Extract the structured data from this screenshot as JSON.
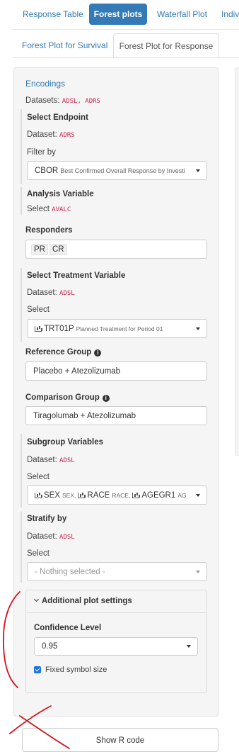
{
  "top_tabs": [
    "Response Table",
    "Forest plots",
    "Waterfall Plot",
    "Indiv"
  ],
  "sub_tabs": [
    "Forest Plot for Survival",
    "Forest Plot for Response"
  ],
  "encodings": {
    "title": "Encodings",
    "datasets_label": "Datasets:",
    "datasets_value": "ADSL, ADRS",
    "endpoint": {
      "title": "Select Endpoint",
      "dataset_label": "Dataset:",
      "dataset_value": "ADRS",
      "filter_label": "Filter by",
      "filter_value": "CBOR",
      "filter_desc": "Best Confirmed Overall Response by Investi"
    },
    "analysis": {
      "title": "Analysis Variable",
      "select_label": "Select",
      "select_value": "AVALC"
    },
    "responders": {
      "title": "Responders",
      "chips": [
        "PR",
        "CR"
      ]
    },
    "treatment": {
      "title": "Select Treatment Variable",
      "dataset_label": "Dataset:",
      "dataset_value": "ADSL",
      "select_label": "Select",
      "value": "TRT01P",
      "desc": "Planned Treatment for Period 01"
    },
    "reference": {
      "title": "Reference Group",
      "value": "Placebo + Atezolizumab"
    },
    "comparison": {
      "title": "Comparison Group",
      "value": "Tiragolumab + Atezolizumab"
    },
    "subgroup": {
      "title": "Subgroup Variables",
      "dataset_label": "Dataset:",
      "dataset_value": "ADSL",
      "select_label": "Select",
      "items": [
        {
          "name": "SEX",
          "desc": "SEX,"
        },
        {
          "name": "RACE",
          "desc": "RACE,"
        },
        {
          "name": "AGEGR1",
          "desc": "AG"
        }
      ]
    },
    "stratify": {
      "title": "Stratify by",
      "dataset_label": "Dataset:",
      "dataset_value": "ADSL",
      "select_label": "Select",
      "placeholder": "- Nothing selected -"
    },
    "additional": {
      "title": "Additional plot settings",
      "confidence_label": "Confidence Level",
      "confidence_value": "0.95",
      "fixed_symbol_label": "Fixed symbol size",
      "fixed_symbol_checked": true
    }
  },
  "show_r_code": "Show R code",
  "colors": {
    "accent": "#337ab7",
    "code": "#c7254e",
    "checkbox": "#1a73e8",
    "annotation": "#d6121f"
  }
}
